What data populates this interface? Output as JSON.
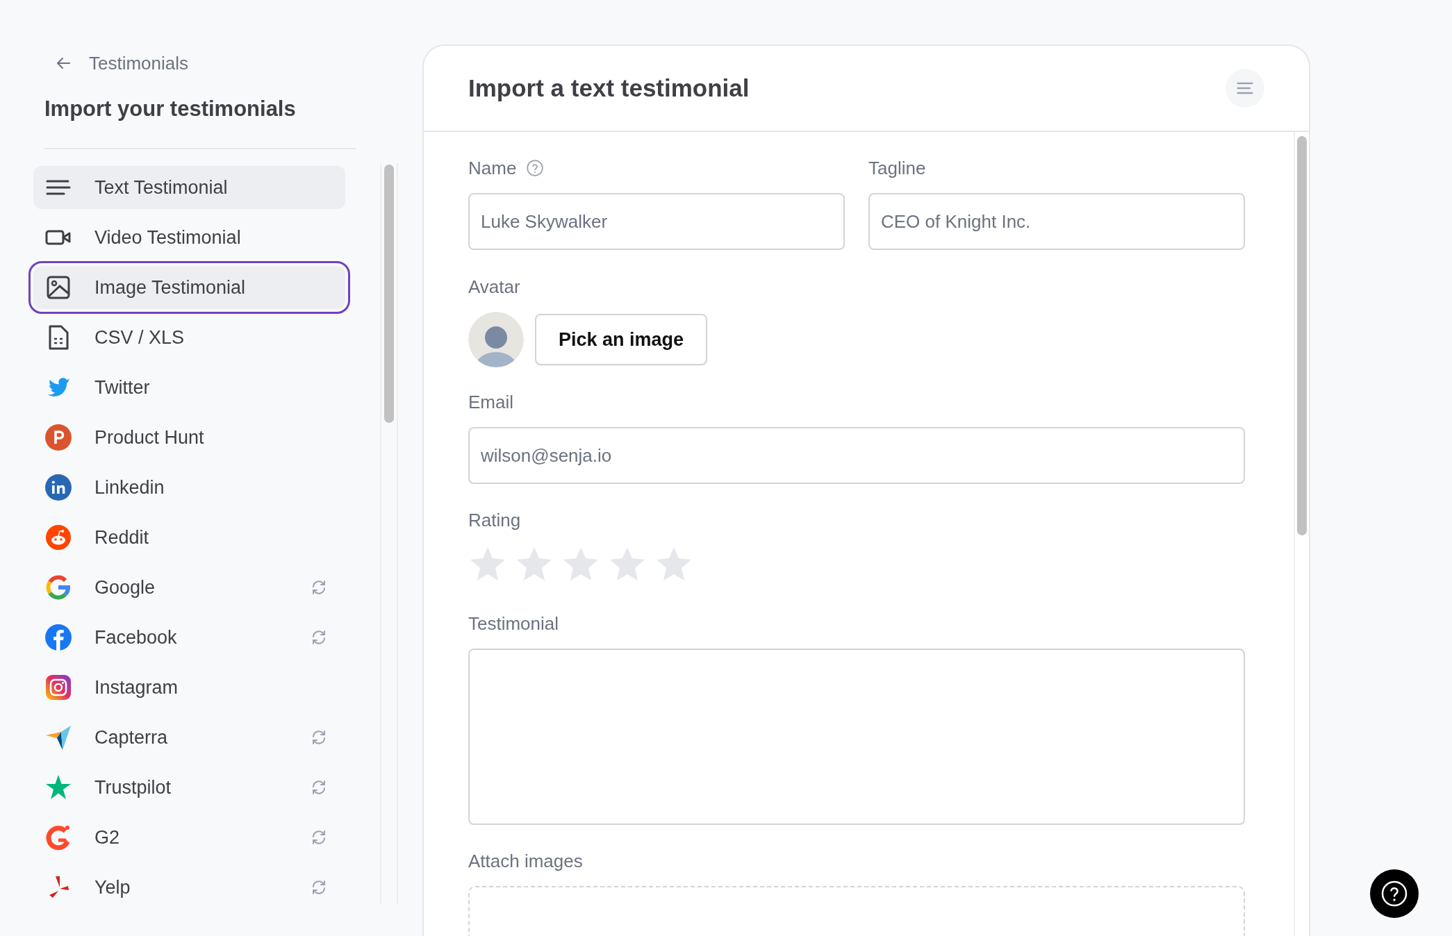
{
  "back_link": {
    "label": "Testimonials"
  },
  "sidebar": {
    "title": "Import your testimonials",
    "items": [
      {
        "label": "Text Testimonial",
        "selected": true,
        "focused": false,
        "sync": false
      },
      {
        "label": "Video Testimonial",
        "selected": false,
        "focused": false,
        "sync": false
      },
      {
        "label": "Image Testimonial",
        "selected": false,
        "focused": true,
        "sync": false
      },
      {
        "label": "CSV / XLS",
        "selected": false,
        "focused": false,
        "sync": false
      },
      {
        "label": "Twitter",
        "selected": false,
        "focused": false,
        "sync": false
      },
      {
        "label": "Product Hunt",
        "selected": false,
        "focused": false,
        "sync": false
      },
      {
        "label": "Linkedin",
        "selected": false,
        "focused": false,
        "sync": false
      },
      {
        "label": "Reddit",
        "selected": false,
        "focused": false,
        "sync": false
      },
      {
        "label": "Google",
        "selected": false,
        "focused": false,
        "sync": true
      },
      {
        "label": "Facebook",
        "selected": false,
        "focused": false,
        "sync": true
      },
      {
        "label": "Instagram",
        "selected": false,
        "focused": false,
        "sync": false
      },
      {
        "label": "Capterra",
        "selected": false,
        "focused": false,
        "sync": true
      },
      {
        "label": "Trustpilot",
        "selected": false,
        "focused": false,
        "sync": true
      },
      {
        "label": "G2",
        "selected": false,
        "focused": false,
        "sync": true
      },
      {
        "label": "Yelp",
        "selected": false,
        "focused": false,
        "sync": true
      }
    ]
  },
  "form": {
    "title": "Import a text testimonial",
    "name": {
      "label": "Name",
      "placeholder": "Luke Skywalker"
    },
    "tagline": {
      "label": "Tagline",
      "placeholder": "CEO of Knight Inc."
    },
    "avatar": {
      "label": "Avatar",
      "button": "Pick an image"
    },
    "email": {
      "label": "Email",
      "placeholder": "wilson@senja.io"
    },
    "rating": {
      "label": "Rating",
      "stars": 0
    },
    "testimonial": {
      "label": "Testimonial"
    },
    "attach": {
      "label": "Attach images"
    }
  }
}
